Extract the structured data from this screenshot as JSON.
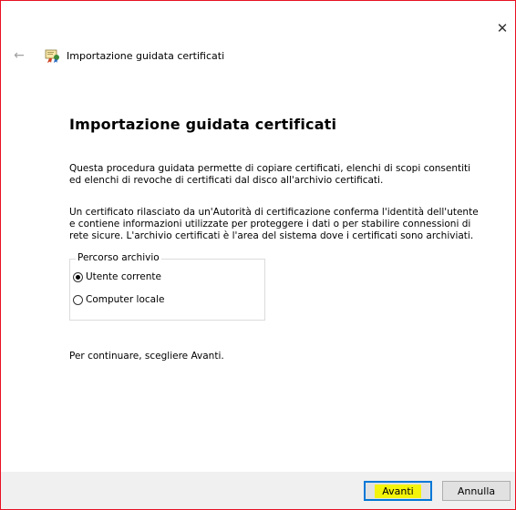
{
  "window": {
    "title": "Importazione guidata certificati",
    "close_glyph": "✕"
  },
  "nav": {
    "back_glyph": "←",
    "icon": "certificate-icon"
  },
  "main": {
    "heading": "Importazione guidata certificati",
    "paragraph1": "Questa procedura guidata permette di copiare certificati, elenchi di scopi consentiti ed elenchi di revoche di certificati dal disco all'archivio certificati.",
    "paragraph2": "Un certificato rilasciato da un'Autorità di certificazione conferma l'identità dell'utente e contiene informazioni utilizzate per proteggere i dati o per stabilire connessioni di rete sicure. L'archivio certificati è l'area del sistema dove i certificati sono archiviati.",
    "store_group": {
      "legend": "Percorso archivio",
      "options": [
        {
          "label": "Utente corrente",
          "checked": true
        },
        {
          "label": "Computer locale",
          "checked": false
        }
      ]
    },
    "paragraph3": "Per continuare, scegliere Avanti."
  },
  "footer": {
    "next_label": "Avanti",
    "cancel_label": "Annulla"
  },
  "colors": {
    "highlight": "#f4f40a",
    "focus_border": "#0078d7",
    "window_border": "#e81123"
  }
}
